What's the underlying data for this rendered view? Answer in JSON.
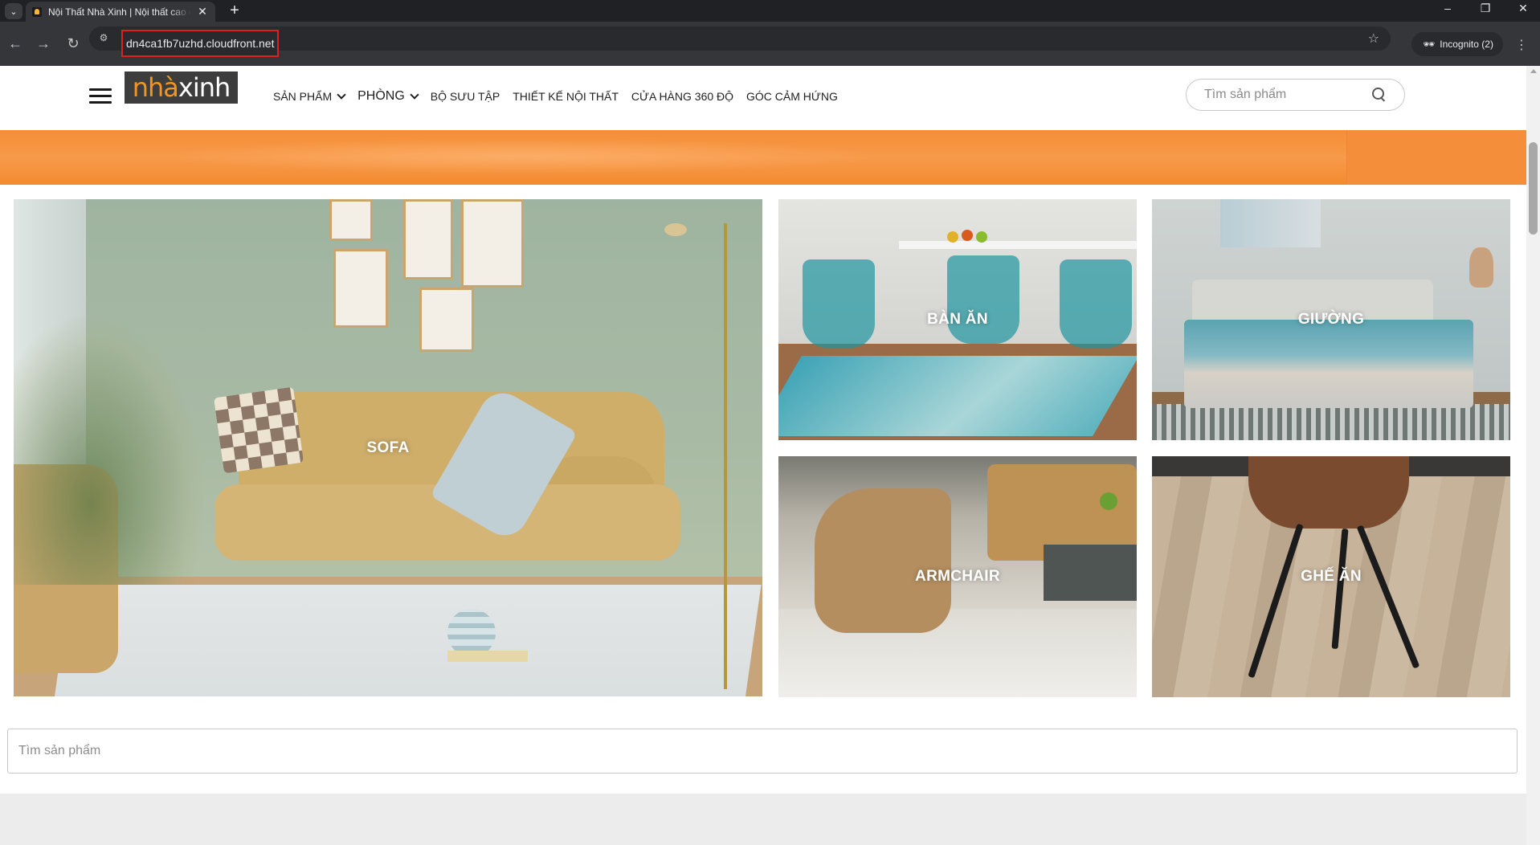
{
  "browser": {
    "tab_title": "Nội Thất Nhà Xinh | Nội thất cao cấp",
    "tab_close": "✕",
    "new_tab": "+",
    "url": "dn4ca1fb7uzhd.cloudfront.net",
    "incognito_label": "Incognito (2)",
    "window_controls": {
      "minimize": "–",
      "restore": "❐",
      "close": "✕"
    }
  },
  "header": {
    "logo": {
      "part1": "nhà",
      "part2": "xinh"
    },
    "menu": [
      {
        "label": "SẢN PHẨM",
        "has_dropdown": true
      },
      {
        "label": "PHÒNG",
        "has_dropdown": true
      },
      {
        "label": "BỘ SƯU TẬP",
        "has_dropdown": false
      },
      {
        "label": "THIẾT KẾ NỘI THẤT",
        "has_dropdown": false
      },
      {
        "label": "CỬA HÀNG 360 ĐỘ",
        "has_dropdown": false
      },
      {
        "label": "GÓC CẢM HỨNG",
        "has_dropdown": false
      }
    ],
    "search_placeholder": "Tìm sản phẩm"
  },
  "categories": [
    {
      "label": "SOFA"
    },
    {
      "label": "BÀN ĂN"
    },
    {
      "label": "GIƯỜNG"
    },
    {
      "label": "ARMCHAIR"
    },
    {
      "label": "GHẾ ĂN"
    }
  ],
  "bottom_search": {
    "placeholder": "Tìm sản phẩm"
  },
  "colors": {
    "brand_orange": "#f7941d",
    "promo_band": "#f58d36",
    "url_highlight": "#e0201f"
  }
}
